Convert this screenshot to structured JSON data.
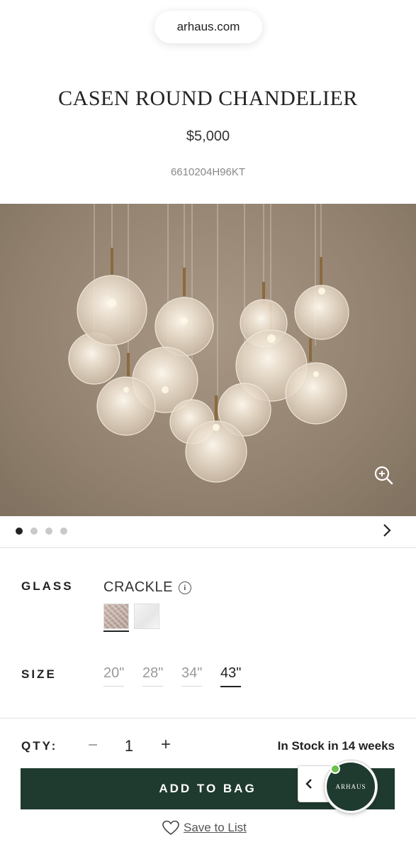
{
  "browser": {
    "url": "arhaus.com"
  },
  "product": {
    "title": "CASEN ROUND CHANDELIER",
    "price": "$5,000",
    "sku": "6610204H96KT"
  },
  "gallery": {
    "dot_count": 4,
    "active_index": 0
  },
  "options": {
    "glass_label": "GLASS",
    "glass_value": "CRACKLE",
    "glass_info_icon": "i",
    "size_label": "SIZE",
    "sizes": [
      "20\"",
      "28\"",
      "34\"",
      "43\""
    ],
    "selected_size": "43\""
  },
  "quantity": {
    "label": "QTY:",
    "minus": "−",
    "value": "1",
    "plus": "+"
  },
  "stock": "In Stock in 14 weeks",
  "add_to_bag": "ADD TO BAG",
  "chat": {
    "badge_text": "ARHAUS",
    "status_color": "#6bbf4e"
  },
  "save_to_list": "Save to List",
  "colors": {
    "brand_green": "#1f3a2f",
    "background": "#ffffff"
  }
}
